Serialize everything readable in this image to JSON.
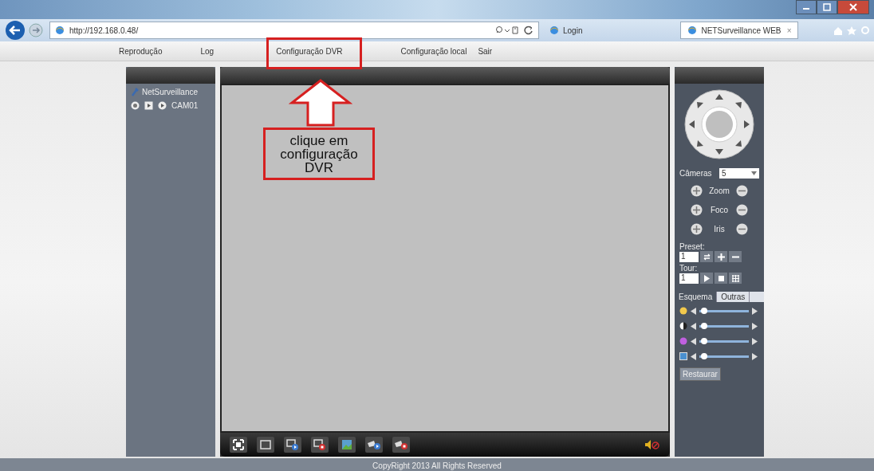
{
  "browser": {
    "url": "http://192.168.0.48/",
    "tabs": [
      {
        "label": "Login",
        "selected": false
      },
      {
        "label": "NETSurveillance WEB",
        "selected": true
      }
    ],
    "close_tab": "×"
  },
  "menu": [
    {
      "label": "Reprodução",
      "selected": false
    },
    {
      "label": "Log",
      "selected": false
    },
    {
      "label": "Configuração DVR",
      "selected": false
    },
    {
      "label": "Configuração local",
      "selected": false
    },
    {
      "label": "Sair",
      "selected": false
    }
  ],
  "device_tree": {
    "root": "NetSurveillance",
    "channels": [
      {
        "name": "CAM01"
      }
    ]
  },
  "ptz": {
    "cameras_label": "Câmeras",
    "cameras_value": "5",
    "controls": [
      {
        "label": "Zoom"
      },
      {
        "label": "Foco"
      },
      {
        "label": "Iris"
      }
    ],
    "preset_label": "Preset:",
    "preset_value": "1",
    "tour_label": "Tour:",
    "tour_value": "1"
  },
  "image_tabs": [
    {
      "label": "Esquema",
      "selected": true
    },
    {
      "label": "Outras",
      "selected": false
    }
  ],
  "sliders": [
    {
      "kind": "brightness",
      "level": 0.05
    },
    {
      "kind": "contrast",
      "level": 0.05
    },
    {
      "kind": "saturation",
      "level": 0.05
    },
    {
      "kind": "hue",
      "level": 0.05
    }
  ],
  "restore_button": "Restaurar",
  "annotation": {
    "lines": [
      "clique em",
      "configuração",
      "DVR"
    ]
  },
  "footer": "CopyRight 2013 All Rights Reserved"
}
